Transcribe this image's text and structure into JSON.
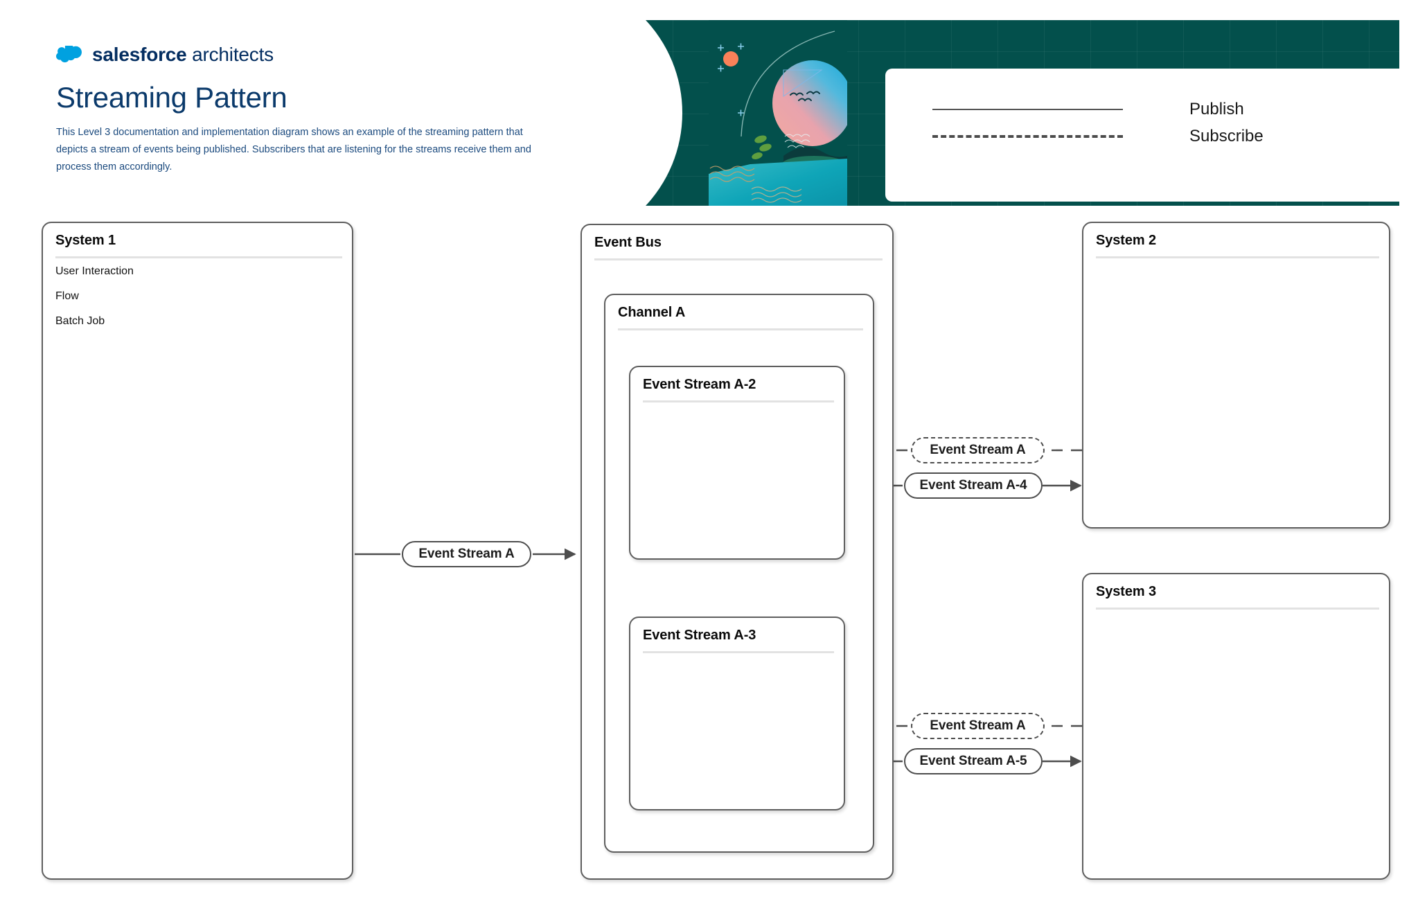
{
  "header": {
    "brand_bold": "salesforce",
    "brand_regular": "architects",
    "title": "Streaming Pattern",
    "description": "This Level 3 documentation and implementation diagram shows an example of the streaming pattern that depicts a stream of events being published. Subscribers that are listening for the streams receive them and process them accordingly.",
    "background_color": "#03504c",
    "brand_cloud_color": "#00a1e0",
    "brand_text_color": "#032d60",
    "title_color": "#0b3a6b"
  },
  "legend": {
    "items": [
      {
        "label": "Publish",
        "style": "solid"
      },
      {
        "label": "Subscribe",
        "style": "dashed"
      }
    ]
  },
  "diagram": {
    "system_1": {
      "title": "System 1",
      "items": [
        "User Interaction",
        "Flow",
        "Batch Job"
      ]
    },
    "event_bus": {
      "title": "Event Bus"
    },
    "channel_a": {
      "title": "Channel A"
    },
    "stream_a2": {
      "title": "Event Stream A-2"
    },
    "stream_a3": {
      "title": "Event Stream A-3"
    },
    "system_2": {
      "title": "System 2"
    },
    "system_3": {
      "title": "System 3"
    },
    "edges": {
      "sys1_publish": {
        "label": "Event Stream A",
        "style": "publish"
      },
      "sys2_subscribe": {
        "label": "Event Stream A",
        "style": "subscribe"
      },
      "sys2_publish": {
        "label": "Event Stream A-4",
        "style": "publish"
      },
      "sys3_subscribe": {
        "label": "Event Stream A",
        "style": "subscribe"
      },
      "sys3_publish": {
        "label": "Event Stream A-5",
        "style": "publish"
      }
    }
  }
}
